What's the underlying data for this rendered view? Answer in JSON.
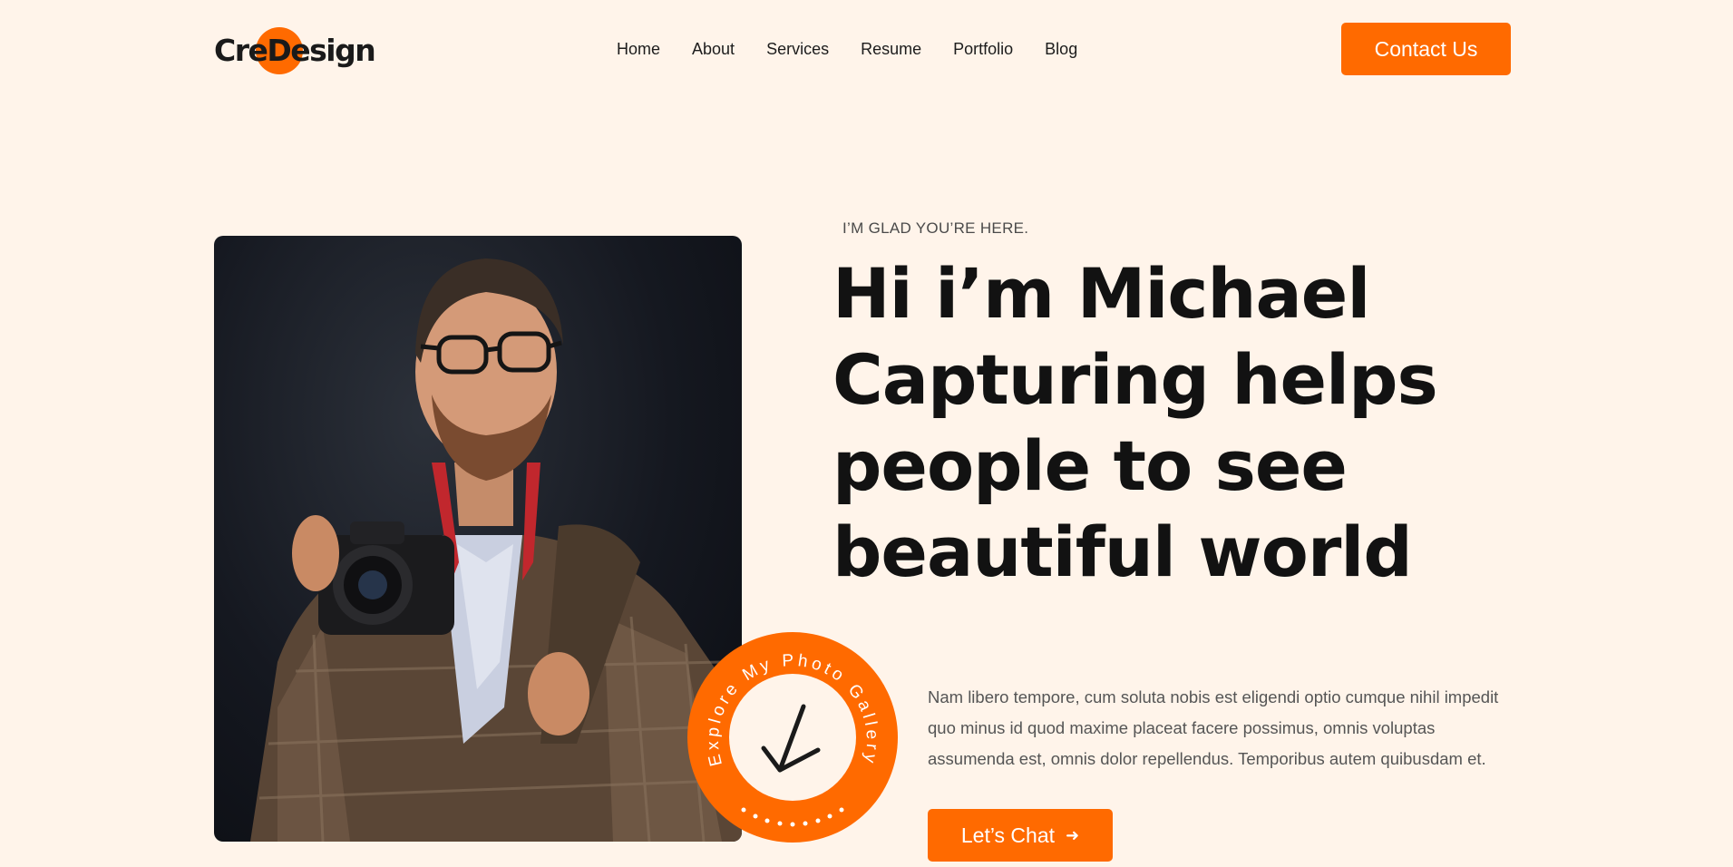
{
  "header": {
    "logo_text": "CreDesign",
    "nav": [
      "Home",
      "About",
      "Services",
      "Resume",
      "Portfolio",
      "Blog"
    ],
    "contact_label": "Contact Us"
  },
  "hero": {
    "eyebrow": "I’M GLAD YOU’RE HERE.",
    "headline_lines": [
      "Hi i’m Michael",
      "Capturing helps",
      "people to see",
      "beautiful world"
    ],
    "description": "Nam libero tempore, cum soluta nobis est eligendi optio cumque nihil impedit quo minus id quod maxime placeat facere possimus, omnis voluptas assumenda est, omnis dolor repellendus. Temporibus autem quibusdam et.",
    "cta_label": "Let’s Chat",
    "cta_icon": "arrow-right-icon",
    "badge_text": "Explore My Photo Gallery",
    "badge_icon": "arrow-down-left-icon"
  },
  "colors": {
    "accent": "#ff6a00",
    "background": "#fff4ea",
    "text": "#121212"
  }
}
